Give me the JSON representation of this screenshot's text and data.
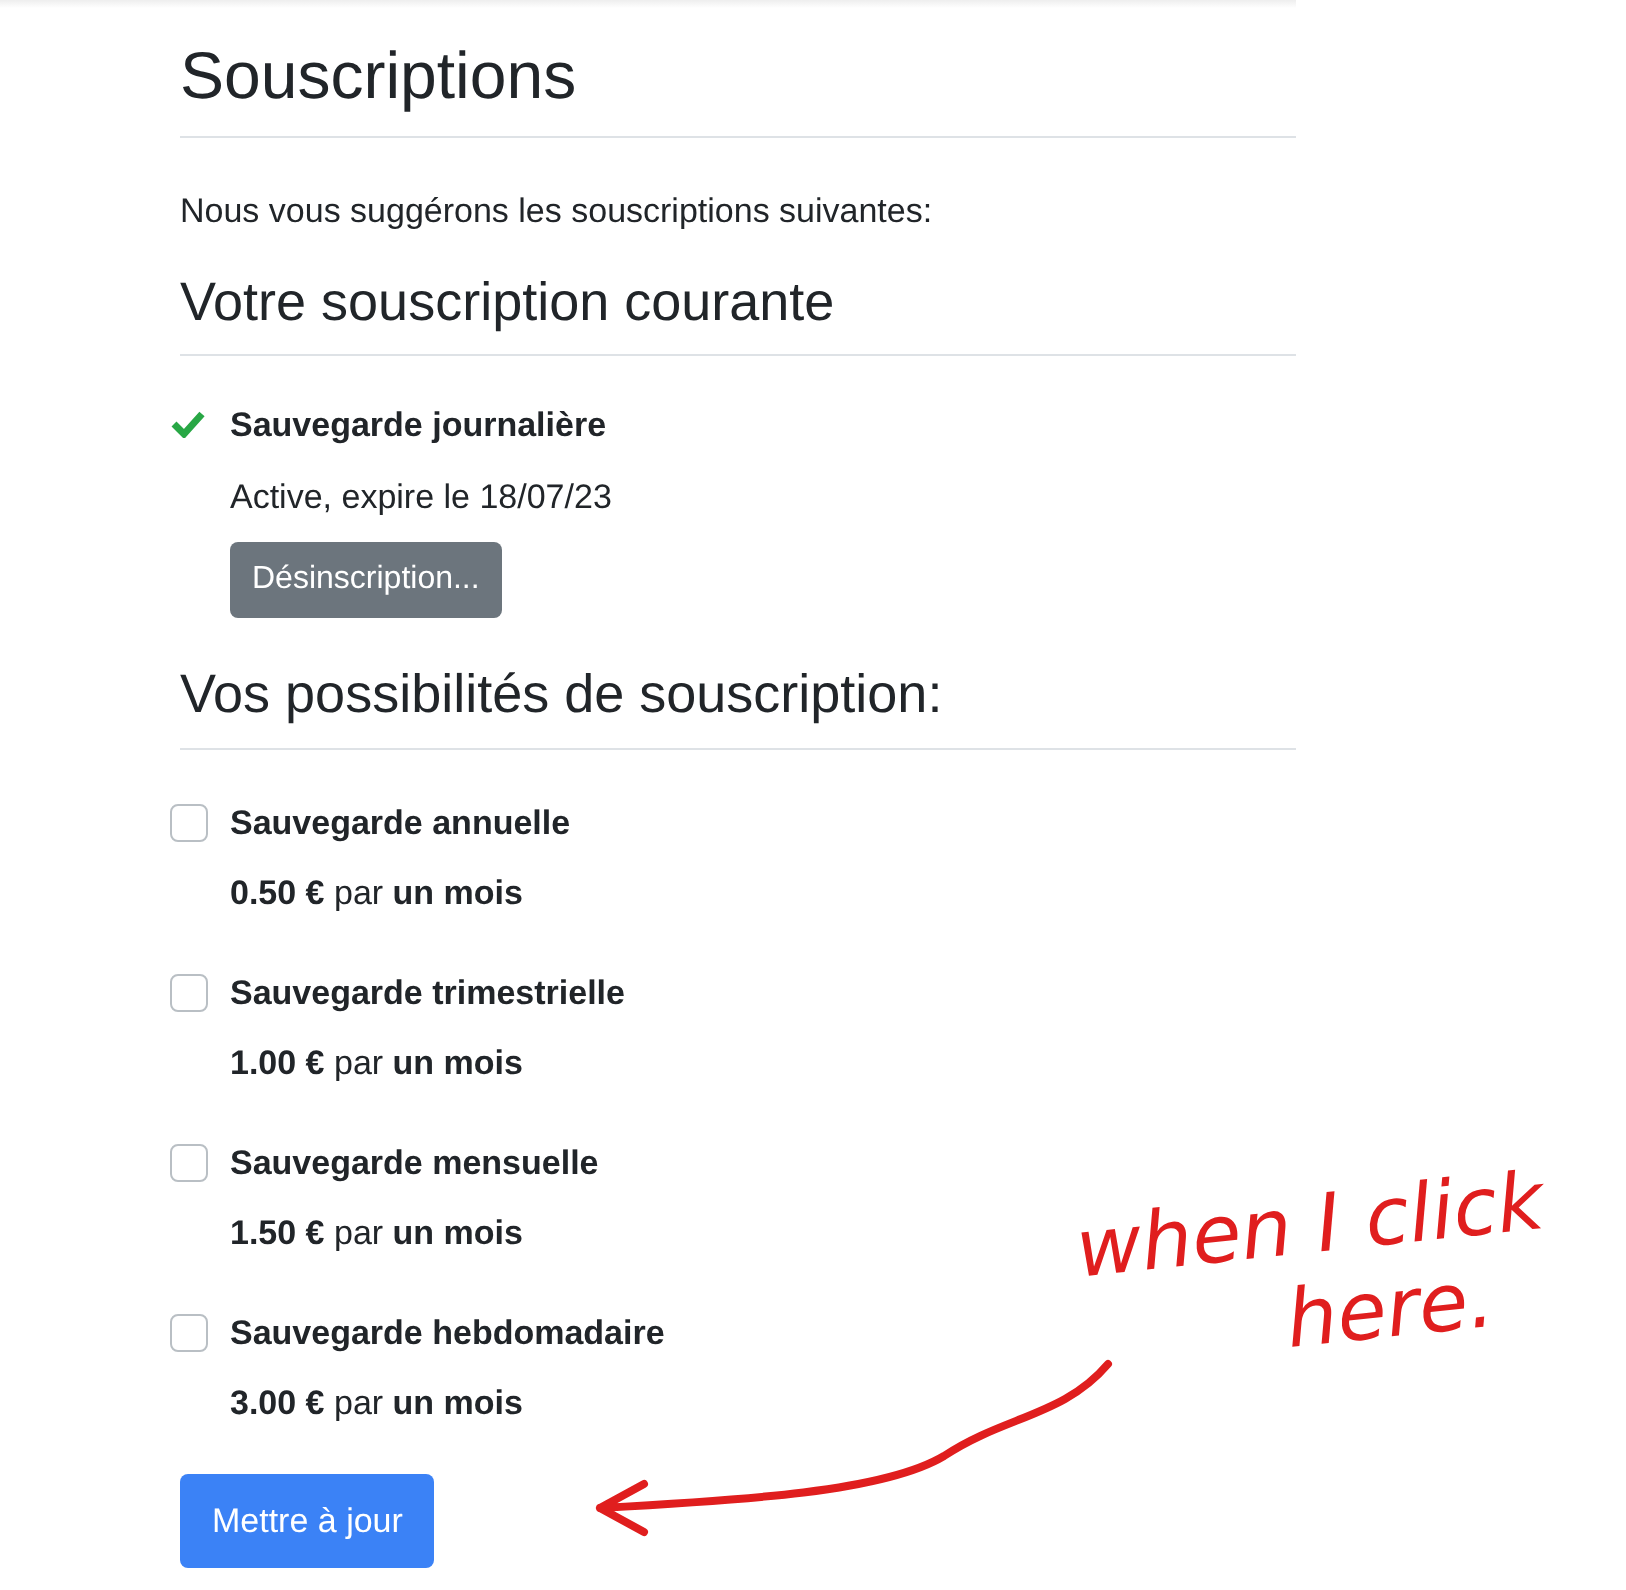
{
  "title": "Souscriptions",
  "intro": "Nous vous suggérons les souscriptions suivantes:",
  "current": {
    "heading": "Votre souscription courante",
    "name": "Sauvegarde journalière",
    "active": true,
    "status": "Active, expire le 18/07/23",
    "button": "Désinscription..."
  },
  "options": {
    "heading": "Vos possibilités de souscription:",
    "items": [
      {
        "name": "Sauvegarde annuelle",
        "price": "**0.50 €** par **un mois**",
        "checked": false
      },
      {
        "name": "Sauvegarde trimestrielle",
        "price": "**1.00 €** par **un mois**",
        "checked": false
      },
      {
        "name": "Sauvegarde mensuelle",
        "price": "**1.50 €** par **un mois**",
        "checked": false
      },
      {
        "name": "Sauvegarde hebdomadaire",
        "price": "**3.00 €** par **un mois**",
        "checked": false
      }
    ]
  },
  "submit": "Mettre à jour",
  "annotation": {
    "lines": [
      "when I click",
      "here."
    ]
  }
}
